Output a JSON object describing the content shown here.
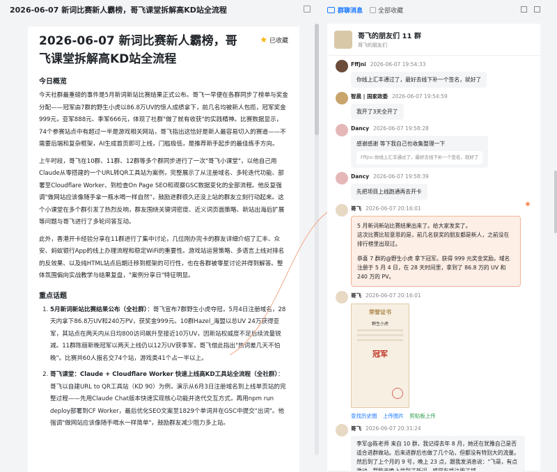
{
  "topbar": {
    "title": "2026-06-07 新词比赛新人霸榜，哥飞课堂拆解高KD站全流程"
  },
  "article": {
    "title": "2026-06-07 新词比赛新人霸榜，哥飞课堂拆解高KD站全流程",
    "favorite": "已收藏",
    "overview_heading": "今日概览",
    "p1": "今天社群最重磅的事件是5月新词新站比赛结果正式公布。哥飞一早便在各群同步了榜单与奖金分配——冠军由7群的野生小虎以86.8万UV的惊人成绩拿下，前几名均被新人包揽，冠军奖金999元，亚军888元、季军666元，体现了社群\"做了就有收获\"的实践精神。比赛数据显示，74个参赛站点中有超过一半是游戏相关网站，哥飞指出这恰好是新人最容易切入的赛道——不需要后端和复杂框架，AI生成首页即可上线，门槛极低，是推荐新手起步的最佳练手方向。",
    "p2": "上午时段，哥飞在10群、11群、12群等多个群同步进行了一次\"哥飞小课堂\"，以他自己用Claude从零搭建的一个URL转QR工具站为案例，完整展示了从注册域名、多轮迭代功能、部署至Cloudflare Worker、到检查On Page SEO和观察GSC数据变化的全部流程。他反复强调\"做网站应该像随手拿一瓶水喝一样自然\"，鼓励进群很久还没上站的群友立刻行动起来。这个小课堂在多个群引发了热烈反响，群友围绕关键词密度、近义词页面策略、新站出海后扩展等问题与哥飞进行了多轮问答互动。",
    "p3": "此外，香港开卡经验分享在11群进行了集中讨论，几位刚办完卡的群友详细介绍了汇丰、众安、蚂蚁银行App的线上办理流程和稳定WiFi的重要性。游戏站运营策略、多语言上线对排名的反效果、以及纯HTML站点后期迁移到框架的可行性，也在各群被零星讨论并得到解答。整体氛围偏向实战教学与结果复盘，\"案例分享日\"特征明显。",
    "key_heading": "重点话题",
    "items": [
      {
        "title": "5月新词新站比赛结果公布（全社群）",
        "body": "：哥飞宣布7群野生小虎夺冠，5月4日注册域名，28天内拿下86.8万UV和240万PV，获奖金999元。10群Hazel_海盟以总UV 24万获得亚军，其站点在两天内从日均800访问飙升至接近10万UV，因新站权威度不足后续流量锐减。11群陈丽新晚冠军以两天上线仍以12万UV获季军，哥飞借此指出\"热词差几天不怕晚\"。比赛共60人报名交74个站，游戏类41个占一半以上。"
      },
      {
        "title": "哥飞课堂：Claude + Cloudflare Worker 快速上线高KD工具站全流程（全社群）",
        "body": "：哥飞以自建URL to QR工具站（KD 90）为例，演示从6月3日注册域名到上线单页站的完整过程——先用Claude Chat版本快速实现核心功能并迭代交互方式，再用npm run deploy部署到CF Worker，最后优化SEO文案至1829个单词并在GSC中提交\"出词\"。他强调\"做网站应该像随手喝水一样简单\"，鼓励群友减少阻力多上站。"
      }
    ]
  },
  "right_header": {
    "tab": "群聊消息",
    "checkbox_label": "全部收藏"
  },
  "group": {
    "name": "哥飞的朋友们 11 群",
    "sub": "哥飞的朋友们"
  },
  "messages": [
    {
      "author": "Fffjni",
      "time": "2026-06-07 19:54:33",
      "text": "你线上汇丰通过了，最好去线下补一个签名，就好了"
    },
    {
      "author": "智晨 | 国家政委",
      "time": "2026-06-07 19:54:59",
      "text": "我开了3天全开了"
    },
    {
      "author": "Dancy",
      "time": "2026-06-07 19:58:28",
      "text": "感谢感谢 等下我自己也收集整理一下",
      "quote": "Fffjnc:你线上汇丰通过了，最好去线下补一个签名，就好了"
    },
    {
      "author": "Dancy",
      "time": "2026-06-07 19:58:39",
      "text": "先把项目上线跑通再去开卡"
    }
  ],
  "highlight": {
    "author": "哥飞",
    "time": "2026-06-07 20:16:01",
    "l1": "5 月新词新站比赛结果出来了。给大家发奖了。",
    "l2": "这次比赛比较意思的是，前几名获奖的朋友都是新人，之前没在排行榜里出现过。",
    "l3": "恭喜 7 群的@野生小虎 拿下冠军。获得 999 元奖金奖励。域名注册于 5 月 4 日，在 28 天时间里，拿到了 86.8 万的 UV 和 240 万的 PV。"
  },
  "image_msg": {
    "author": "哥飞",
    "time": "2026-06-07 20:16:01",
    "cert_title": "荣誉证书",
    "cert_name": "野生小虎",
    "cert_rank": "冠军",
    "links": [
      "查找历史图",
      "上传图片",
      "剪贴板上传"
    ]
  },
  "last_msg": {
    "author": "哥飞",
    "time": "2026-06-07 20:31:24",
    "text": "李军@陈老师 来自 10 群，我记得去年 8 月，她还在犹豫自己是否适合进群做站。后来进群后也做了几个站，但都没有特别大的流量。然后到了上个月的 9 号，晚上 23 点，跟我发消息说：\"飞哥，有点激动，我昨天晚上找到了新词，感觉有戏注册了域"
  },
  "colors": {
    "accent": "#1677ff",
    "highlight_bg": "#fdeee6",
    "highlight_border": "#f3b49a",
    "dot": "#ff7a3d"
  }
}
